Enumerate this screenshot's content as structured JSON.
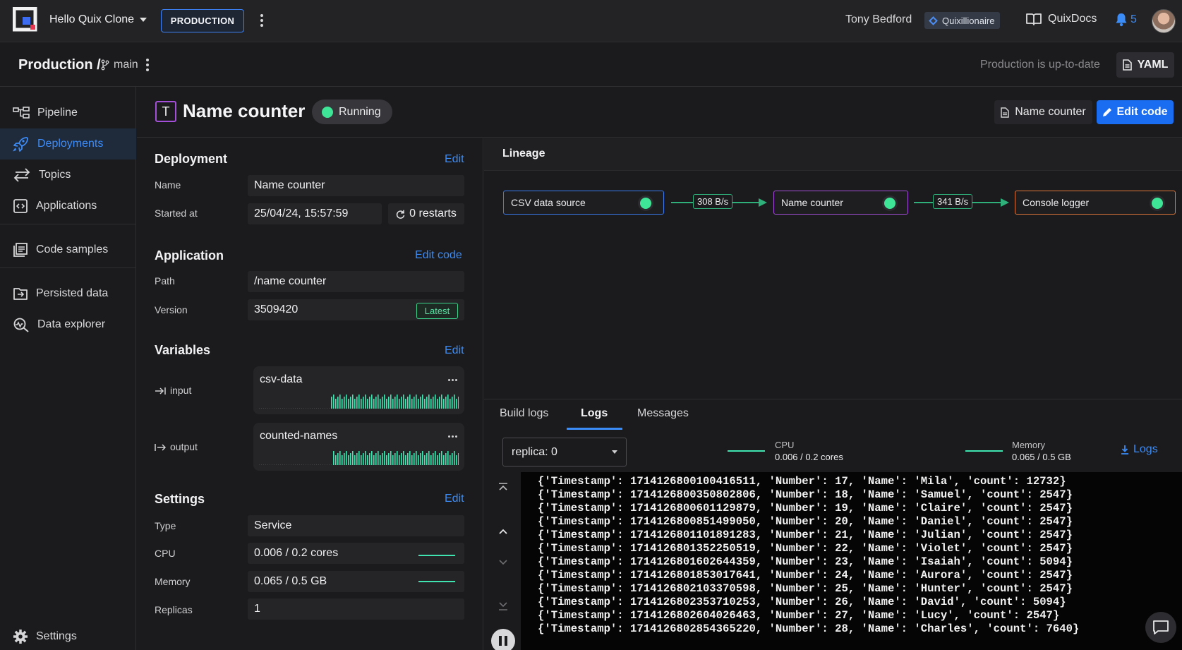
{
  "topbar": {
    "project_name": "Hello Quix Clone",
    "environment": "PRODUCTION",
    "user_name": "Tony Bedford",
    "plan": "Quixillionaire",
    "docs_label": "QuixDocs",
    "notification_count": "5"
  },
  "subbar": {
    "environment_title": "Production /",
    "branch": "main",
    "status": "Production is up-to-date",
    "yaml_label": "YAML"
  },
  "sidebar": {
    "items": [
      {
        "label": "Pipeline",
        "icon": "pipeline-icon"
      },
      {
        "label": "Deployments",
        "icon": "rocket-icon",
        "active": true
      },
      {
        "label": "Topics",
        "icon": "arrows-icon"
      },
      {
        "label": "Applications",
        "icon": "code-icon"
      },
      {
        "label": "Code samples",
        "icon": "library-icon"
      },
      {
        "label": "Persisted data",
        "icon": "persisted-icon"
      },
      {
        "label": "Data explorer",
        "icon": "explorer-icon"
      }
    ],
    "settings_label": "Settings"
  },
  "header": {
    "type_badge": "T",
    "title": "Name counter",
    "status": "Running",
    "file_button": "Name counter",
    "edit_code_button": "Edit code"
  },
  "deployment": {
    "title": "Deployment",
    "edit_label": "Edit",
    "name_label": "Name",
    "name_value": "Name counter",
    "started_label": "Started at",
    "started_value": "25/04/24, 15:57:59",
    "restarts": "0 restarts"
  },
  "application": {
    "title": "Application",
    "edit_label": "Edit code",
    "path_label": "Path",
    "path_value": "/name counter",
    "version_label": "Version",
    "version_value": "3509420",
    "version_badge": "Latest"
  },
  "variables": {
    "title": "Variables",
    "edit_label": "Edit",
    "items": [
      {
        "label": "input",
        "value": "csv-data"
      },
      {
        "label": "output",
        "value": "counted-names"
      }
    ]
  },
  "settings": {
    "title": "Settings",
    "edit_label": "Edit",
    "type_label": "Type",
    "type_value": "Service",
    "cpu_label": "CPU",
    "cpu_value": "0.006 / 0.2 cores",
    "memory_label": "Memory",
    "memory_value": "0.065 / 0.5 GB",
    "replicas_label": "Replicas",
    "replicas_value": "1"
  },
  "lineage": {
    "title": "Lineage",
    "nodes": [
      {
        "name": "CSV data source",
        "color": "#3a7bf0"
      },
      {
        "name": "Name counter",
        "color": "#a34fd8"
      },
      {
        "name": "Console logger",
        "color": "#e0773a"
      }
    ],
    "rates": [
      "308 B/s",
      "341 B/s"
    ]
  },
  "logs": {
    "tabs": [
      "Build logs",
      "Logs",
      "Messages"
    ],
    "active_tab": "Logs",
    "replica": "replica: 0",
    "cpu_label": "CPU",
    "cpu_value": "0.006 / 0.2 cores",
    "memory_label": "Memory",
    "memory_value": "0.065 / 0.5 GB",
    "download_label": "Logs",
    "lines": [
      "{'Timestamp': 1714126800100416511, 'Number': 17, 'Name': 'Mila', 'count': 12732}",
      "{'Timestamp': 1714126800350802806, 'Number': 18, 'Name': 'Samuel', 'count': 2547}",
      "{'Timestamp': 1714126800601129879, 'Number': 19, 'Name': 'Claire', 'count': 2547}",
      "{'Timestamp': 1714126800851499050, 'Number': 20, 'Name': 'Daniel', 'count': 2547}",
      "{'Timestamp': 1714126801101891283, 'Number': 21, 'Name': 'Julian', 'count': 2547}",
      "{'Timestamp': 1714126801352250519, 'Number': 22, 'Name': 'Violet', 'count': 2547}",
      "{'Timestamp': 1714126801602644359, 'Number': 23, 'Name': 'Isaiah', 'count': 5094}",
      "{'Timestamp': 1714126801853017641, 'Number': 24, 'Name': 'Aurora', 'count': 2547}",
      "{'Timestamp': 1714126802103370598, 'Number': 25, 'Name': 'Hunter', 'count': 2547}",
      "{'Timestamp': 1714126802353710253, 'Number': 26, 'Name': 'David', 'count': 5094}",
      "{'Timestamp': 1714126802604026463, 'Number': 27, 'Name': 'Lucy', 'count': 2547}",
      "{'Timestamp': 1714126802854365220, 'Number': 28, 'Name': 'Charles', 'count': 7640}"
    ]
  },
  "colors": {
    "accent": "#3b8cf7",
    "running": "#3fe596",
    "flow": "#2fb07a"
  }
}
